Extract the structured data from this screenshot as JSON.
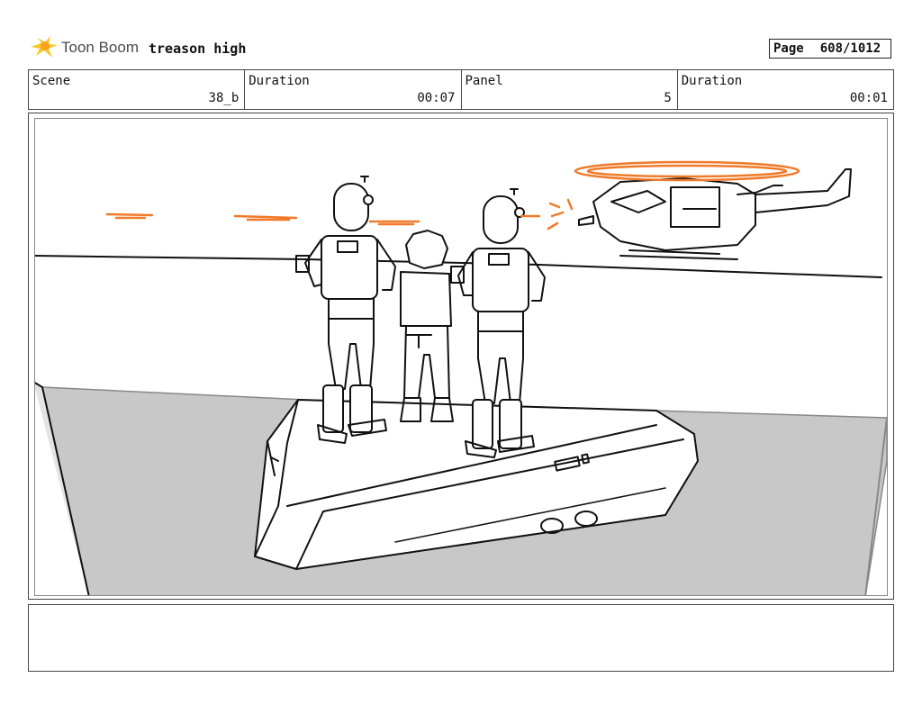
{
  "app": {
    "logo_text": "Toon Boom",
    "project_title": "treason high"
  },
  "page": {
    "label": "Page",
    "value": "608/1012"
  },
  "info": {
    "scene_label": "Scene",
    "scene_value": "38_b",
    "scene_duration_label": "Duration",
    "scene_duration_value": "00:07",
    "panel_label": "Panel",
    "panel_value": "5",
    "panel_duration_label": "Duration",
    "panel_duration_value": "00:01"
  },
  "notes": {
    "text": ""
  },
  "colors": {
    "sketch_line": "#111111",
    "accent_orange": "#f07a2a",
    "ground_grey": "#c8c8c8",
    "logo_yellow": "#f3c928"
  }
}
